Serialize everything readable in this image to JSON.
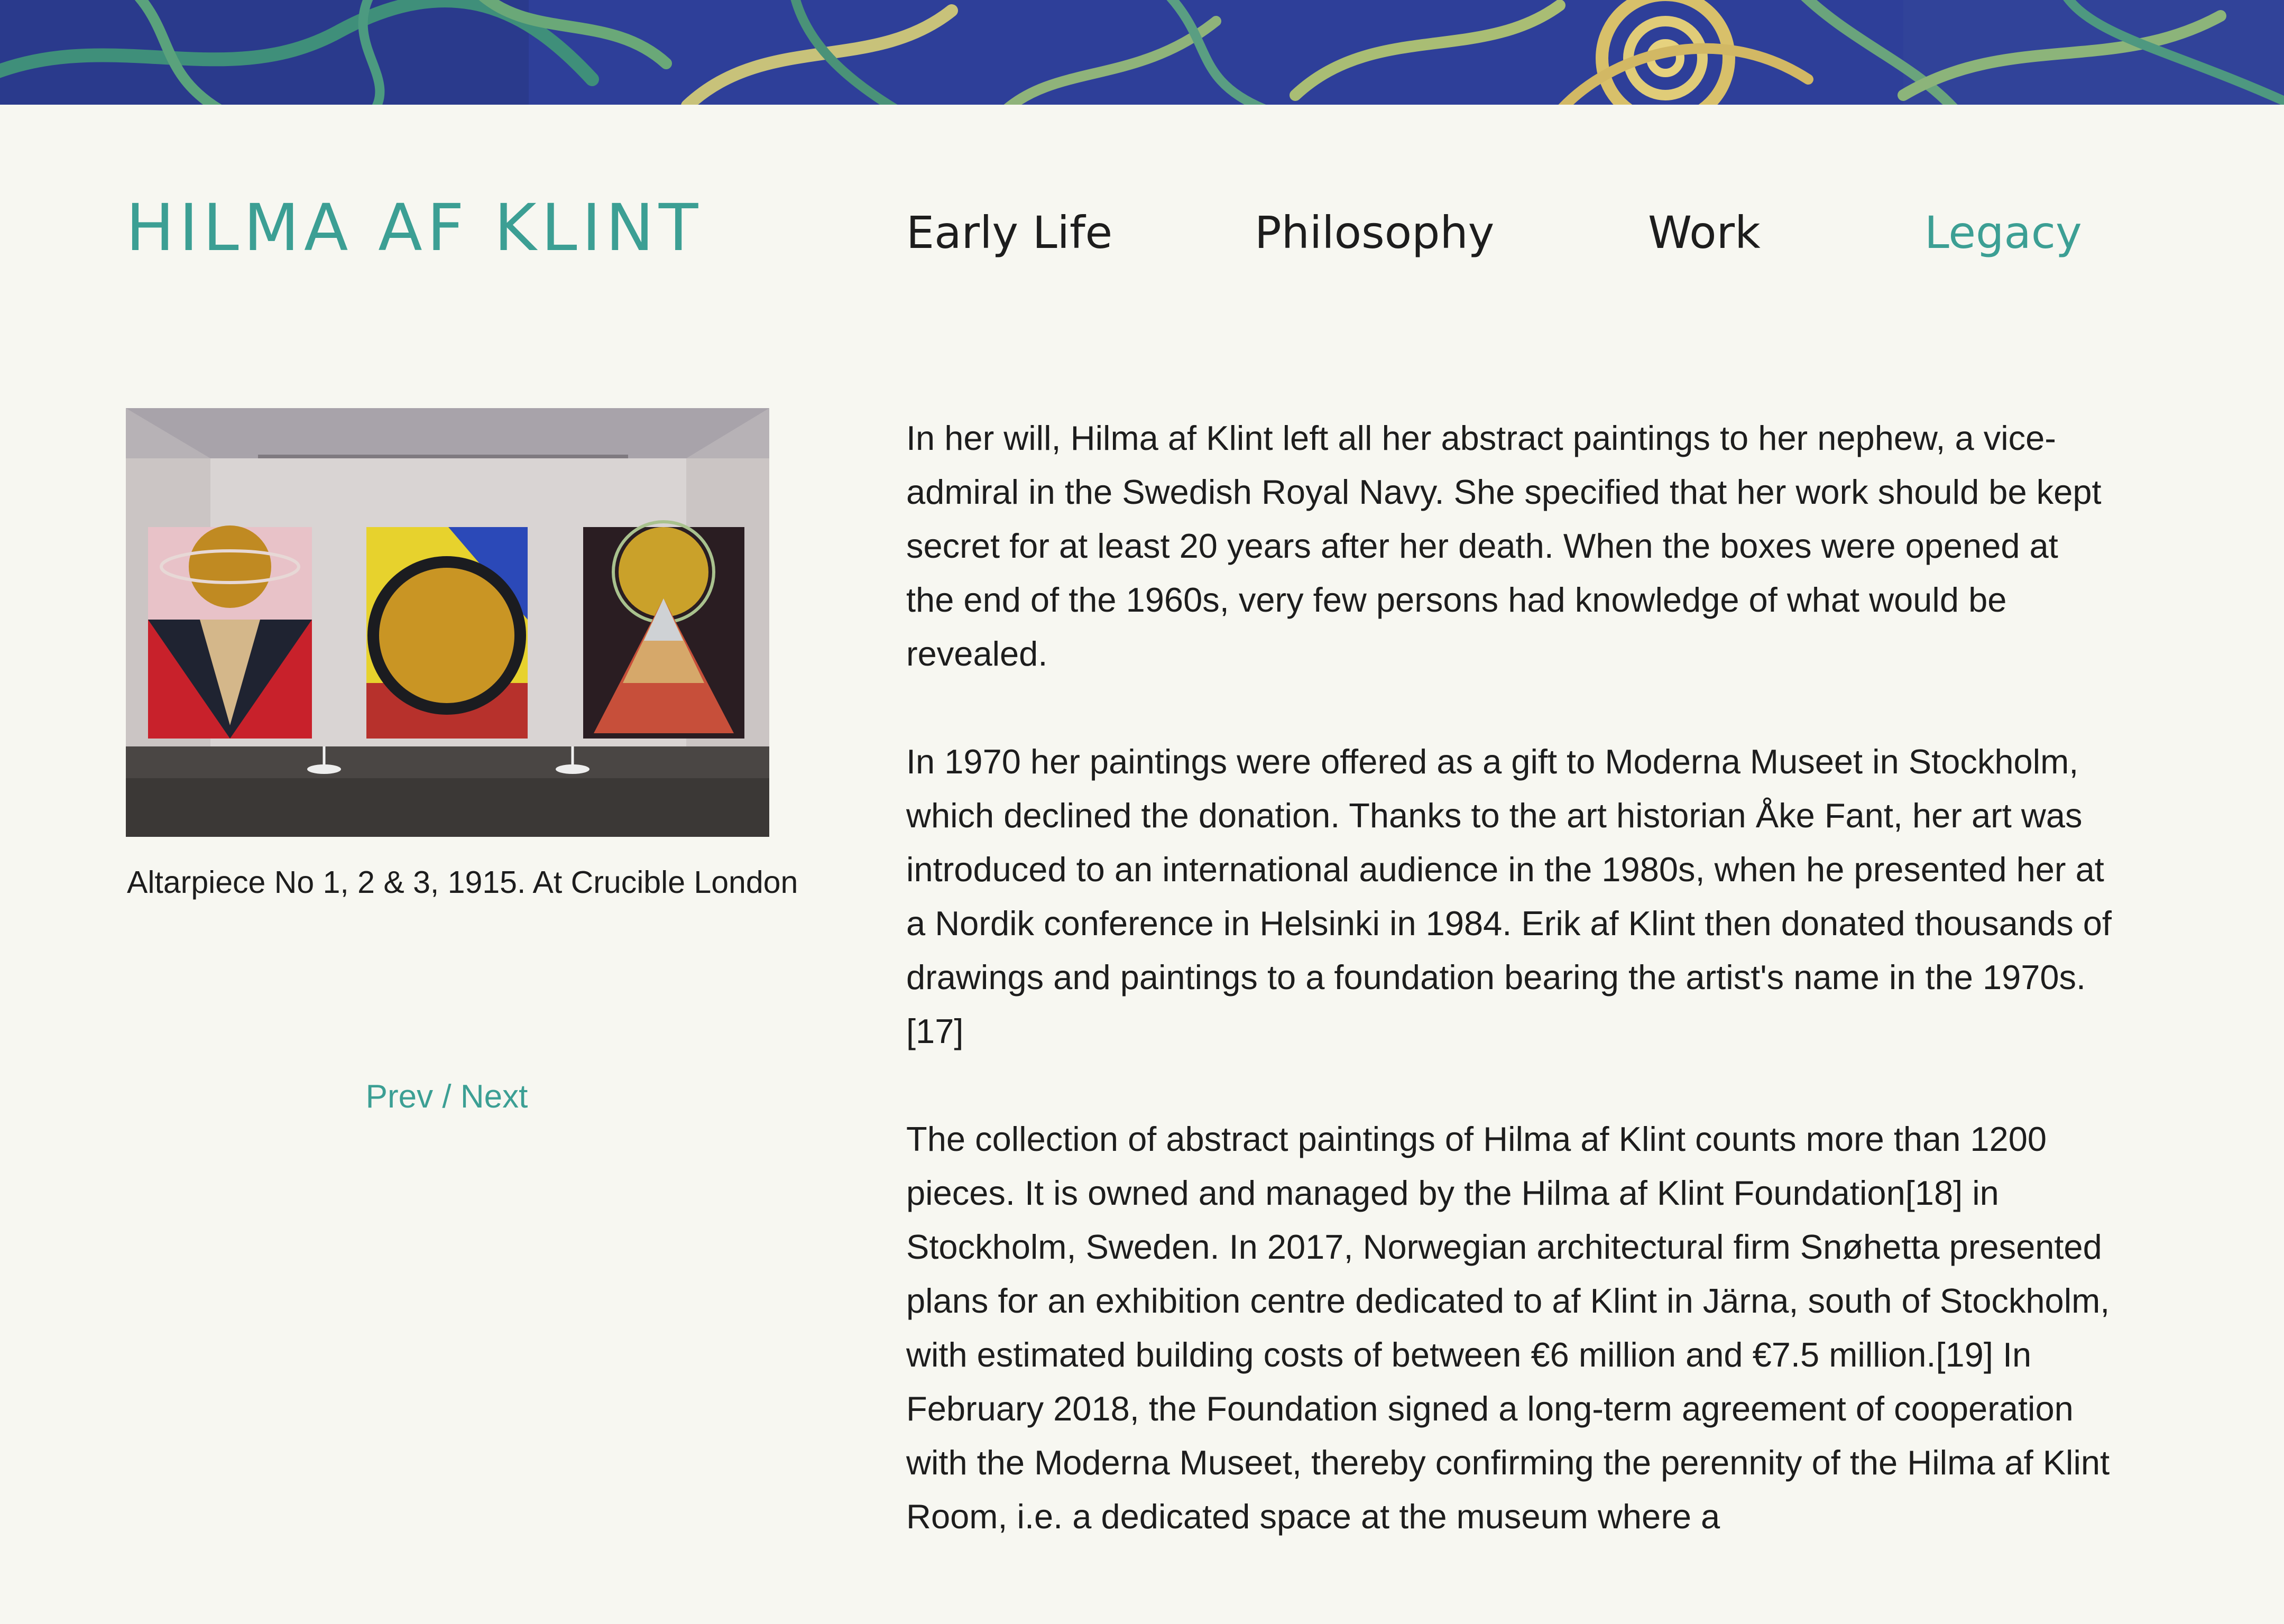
{
  "site": {
    "title": "HILMA AF KLINT"
  },
  "nav": {
    "items": [
      {
        "label": "Early Life",
        "active": false
      },
      {
        "label": "Philosophy",
        "active": false
      },
      {
        "label": "Work",
        "active": false
      },
      {
        "label": "Legacy",
        "active": true
      }
    ]
  },
  "gallery": {
    "caption": "Altarpiece No 1, 2 & 3, 1915. At Crucible London",
    "prev_label": "Prev",
    "separator": "/",
    "next_label": "Next"
  },
  "article": {
    "paragraphs": [
      "In her will, Hilma af Klint left all her abstract paintings to her nephew, a vice-admiral in the Swedish Royal Navy. She specified that her work should be kept secret for at least 20 years after her death. When the boxes were opened at the end of the 1960s, very few persons had knowledge of what would be revealed.",
      "In 1970 her paintings were offered as a gift to Moderna Museet in Stockholm, which declined the donation. Thanks to the art historian Åke Fant, her art was introduced to an international audience in the 1980s, when he presented her at a Nordik conference in Helsinki in 1984. Erik af Klint then donated thousands of drawings and paintings to a foundation bearing the artist's name in the 1970s.[17]",
      "The collection of abstract paintings of Hilma af Klint counts more than 1200 pieces. It is owned and managed by the Hilma af Klint Foundation[18] in Stockholm, Sweden. In 2017, Norwegian architectural firm Snøhetta presented plans for an exhibition centre dedicated to af Klint in Järna, south of Stockholm, with estimated building costs of between €6 million and €7.5 million.[19] In February 2018, the Foundation signed a long-term agreement of cooperation with the Moderna Museet, thereby confirming the perennity of the Hilma af Klint Room, i.e. a dedicated space at the museum where a"
    ]
  },
  "colors": {
    "accent": "#3c9f94",
    "background": "#f7f7f1",
    "text": "#1d1d1d",
    "banner_blue": "#2e3f99"
  }
}
